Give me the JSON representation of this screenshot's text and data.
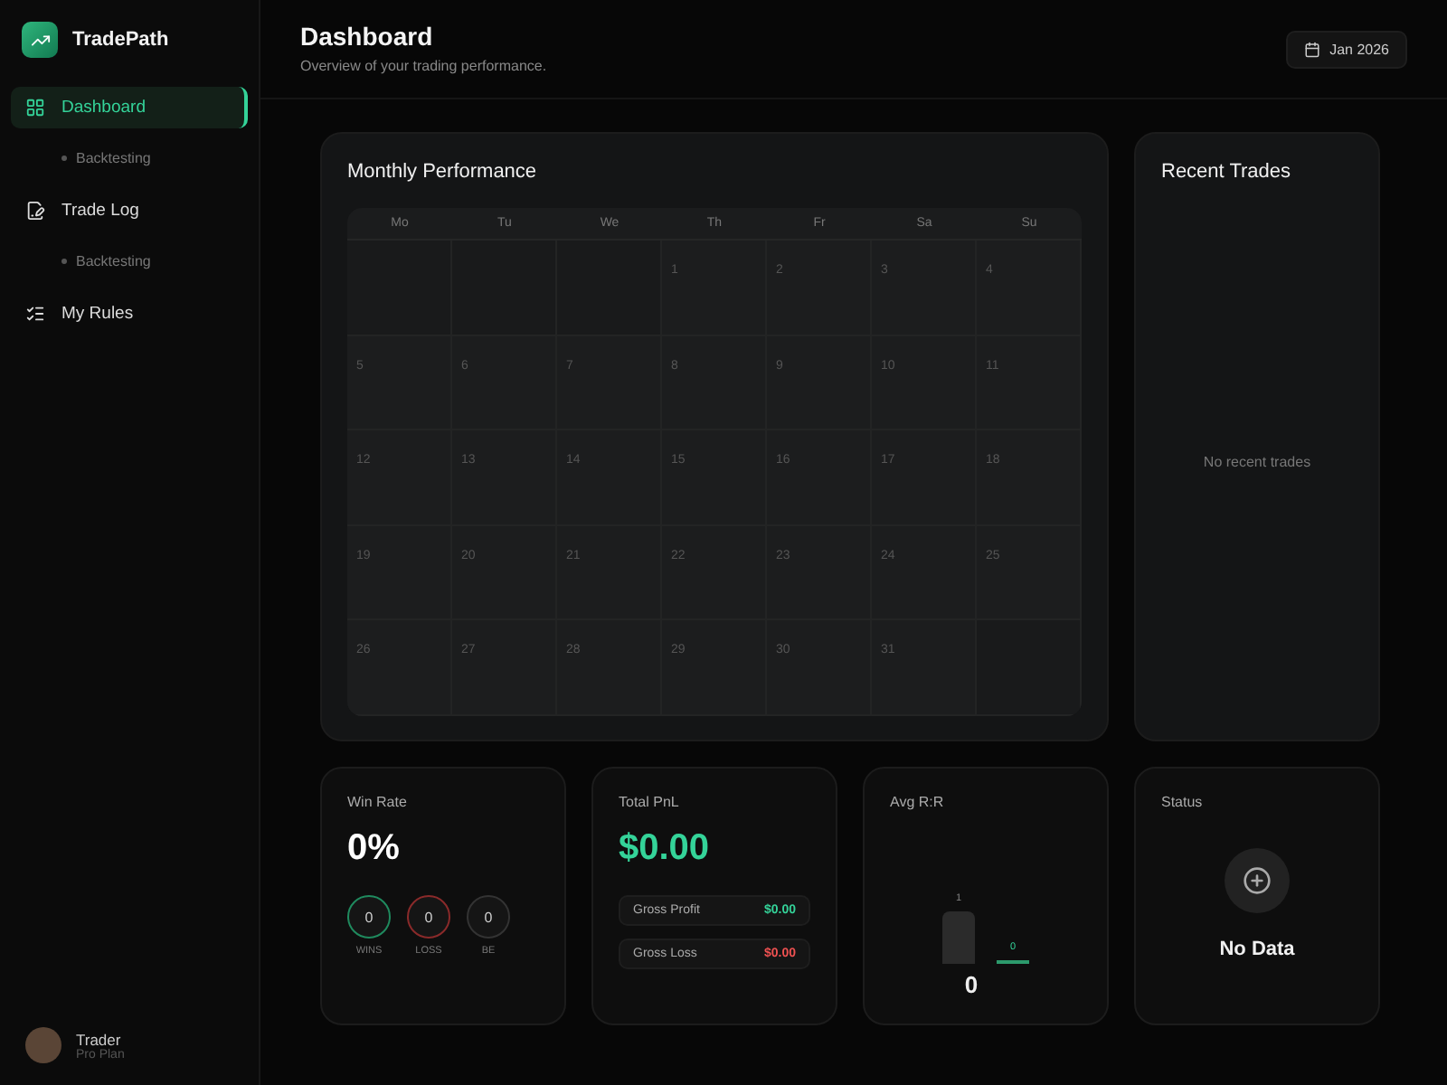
{
  "brand": {
    "name": "TradePath"
  },
  "nav": [
    {
      "label": "Dashboard",
      "selected": true,
      "children": [
        {
          "label": "Backtesting",
          "selected": false
        }
      ]
    },
    {
      "label": "Trade Log",
      "selected": false,
      "children": [
        {
          "label": "Backtesting",
          "selected": false
        }
      ]
    },
    {
      "label": "My Rules",
      "selected": false
    }
  ],
  "user": {
    "name": "Trader",
    "plan": "Pro Plan"
  },
  "header": {
    "title": "Dashboard",
    "subtitle": "Overview of your trading performance.",
    "date_button": "Jan 2026"
  },
  "calendar": {
    "title": "Monthly Performance",
    "weekdays": [
      "Mo",
      "Tu",
      "We",
      "Th",
      "Fr",
      "Sa",
      "Su"
    ],
    "cells": [
      {
        "kind": "empty"
      },
      {
        "kind": "empty"
      },
      {
        "kind": "empty"
      },
      {
        "kind": "day",
        "label": "1"
      },
      {
        "kind": "day",
        "label": "2"
      },
      {
        "kind": "day",
        "label": "3"
      },
      {
        "kind": "day",
        "label": "4"
      },
      {
        "kind": "day",
        "label": "5"
      },
      {
        "kind": "day",
        "label": "6"
      },
      {
        "kind": "day",
        "label": "7"
      },
      {
        "kind": "day",
        "label": "8"
      },
      {
        "kind": "day",
        "label": "9"
      },
      {
        "kind": "day",
        "label": "10"
      },
      {
        "kind": "day",
        "label": "11"
      },
      {
        "kind": "day",
        "label": "12"
      },
      {
        "kind": "day",
        "label": "13"
      },
      {
        "kind": "day",
        "label": "14"
      },
      {
        "kind": "day",
        "label": "15"
      },
      {
        "kind": "day",
        "label": "16"
      },
      {
        "kind": "day",
        "label": "17"
      },
      {
        "kind": "day",
        "label": "18"
      },
      {
        "kind": "day",
        "label": "19"
      },
      {
        "kind": "day",
        "label": "20"
      },
      {
        "kind": "day",
        "label": "21"
      },
      {
        "kind": "day",
        "label": "22"
      },
      {
        "kind": "day",
        "label": "23"
      },
      {
        "kind": "day",
        "label": "24"
      },
      {
        "kind": "day",
        "label": "25"
      },
      {
        "kind": "day",
        "label": "26"
      },
      {
        "kind": "day",
        "label": "27"
      },
      {
        "kind": "day",
        "label": "28"
      },
      {
        "kind": "day",
        "label": "29"
      },
      {
        "kind": "day",
        "label": "30"
      },
      {
        "kind": "day",
        "label": "31"
      },
      {
        "kind": "empty"
      }
    ]
  },
  "recent_trades": {
    "title": "Recent Trades",
    "empty_text": "No recent trades"
  },
  "win_rate": {
    "title": "Win Rate",
    "value": "0%",
    "counts": [
      {
        "value": "0",
        "label": "WINS",
        "color": "#1f8a5e"
      },
      {
        "value": "0",
        "label": "LOSS",
        "color": "#8a2a2a"
      },
      {
        "value": "0",
        "label": "BE",
        "color": "#333333"
      }
    ]
  },
  "pnl": {
    "title": "Total PnL",
    "value": "$0.00",
    "rows": [
      {
        "label": "Gross Profit",
        "value": "$0.00",
        "color": "#34d399"
      },
      {
        "label": "Gross Loss",
        "value": "$0.00",
        "color": "#f05252"
      }
    ]
  },
  "avg_rr": {
    "title": "Avg R:R",
    "risk_label": "1",
    "reward_label": "0",
    "value": "0"
  },
  "status": {
    "title": "Status",
    "value": "No Data"
  }
}
